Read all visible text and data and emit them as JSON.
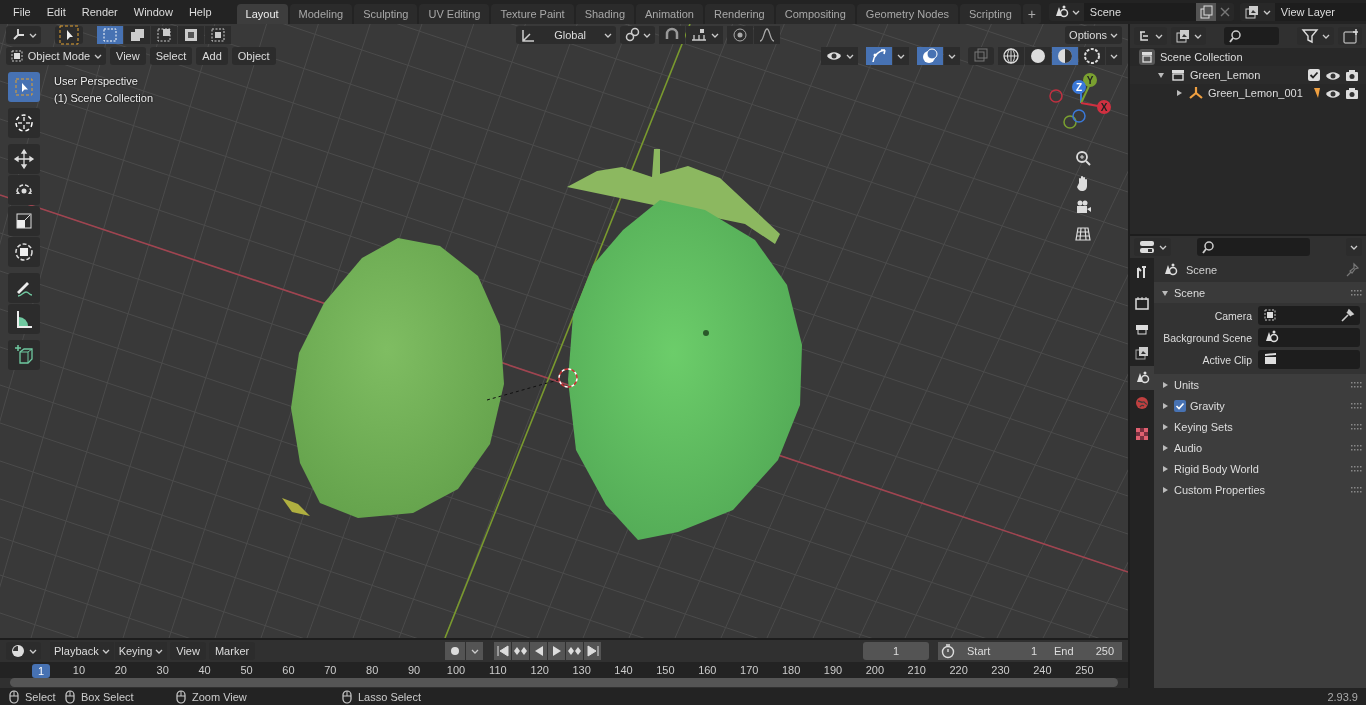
{
  "top_bar": {
    "menus": [
      "File",
      "Edit",
      "Render",
      "Window",
      "Help"
    ],
    "workspace_tabs": [
      {
        "label": "Layout",
        "selected": true
      },
      {
        "label": "Modeling",
        "selected": false
      },
      {
        "label": "Sculpting",
        "selected": false
      },
      {
        "label": "UV Editing",
        "selected": false
      },
      {
        "label": "Texture Paint",
        "selected": false
      },
      {
        "label": "Shading",
        "selected": false
      },
      {
        "label": "Animation",
        "selected": false
      },
      {
        "label": "Rendering",
        "selected": false
      },
      {
        "label": "Compositing",
        "selected": false
      },
      {
        "label": "Geometry Nodes",
        "selected": false
      },
      {
        "label": "Scripting",
        "selected": false
      }
    ],
    "add_workspace": "+",
    "scene": "Scene",
    "view_layer": "View Layer"
  },
  "viewport": {
    "header": {
      "select_modes": [
        {
          "selected": true
        },
        {
          "selected": false
        },
        {
          "selected": false
        },
        {
          "selected": false
        },
        {
          "selected": false
        }
      ],
      "orientation": "Global",
      "options": "Options",
      "mode": "Object Mode",
      "menus": [
        "View",
        "Select",
        "Add",
        "Object"
      ],
      "toggles": [
        {
          "selected": false
        },
        {
          "selected": true
        },
        {
          "selected": true
        }
      ],
      "shading_modes": [
        {
          "selected": false
        },
        {
          "selected": false
        },
        {
          "selected": true
        },
        {
          "selected": false
        }
      ]
    },
    "info": [
      "User Perspective",
      "(1) Scene Collection"
    ],
    "tools": [
      {
        "selected": true
      },
      {
        "selected": false
      },
      {
        "selected": false
      },
      {
        "selected": false
      },
      {
        "selected": false
      },
      {
        "selected": false
      },
      {
        "selected": false
      },
      {
        "selected": false
      },
      {
        "selected": false
      }
    ],
    "gizmo_labels": [
      "X",
      "Y",
      "Z"
    ]
  },
  "outliner": {
    "items": [
      {
        "label": "Scene Collection",
        "kind": "scene",
        "children": [
          {
            "label": "Green_Lemon",
            "kind": "collection",
            "expanded": true,
            "checked": true,
            "children": [
              {
                "label": "Green_Lemon_001",
                "kind": "object",
                "expanded": false
              }
            ]
          }
        ]
      }
    ]
  },
  "properties": {
    "tabs": [
      {
        "selected": false
      },
      {
        "selected": false
      },
      {
        "selected": false
      },
      {
        "selected": false
      },
      {
        "selected": true
      },
      {
        "selected": false
      },
      {
        "selected": false
      }
    ],
    "context": "Scene",
    "panels": [
      {
        "label": "Scene",
        "expanded": true,
        "fields": [
          {
            "label": "Camera",
            "kind": "object"
          },
          {
            "label": "Background Scene",
            "kind": "scene"
          },
          {
            "label": "Active Clip",
            "kind": "clip"
          }
        ]
      },
      {
        "label": "Units",
        "expanded": false
      },
      {
        "label": "Gravity",
        "expanded": false,
        "checked": true
      },
      {
        "label": "Keying Sets",
        "expanded": false
      },
      {
        "label": "Audio",
        "expanded": false
      },
      {
        "label": "Rigid Body World",
        "expanded": false
      },
      {
        "label": "Custom Properties",
        "expanded": false
      }
    ]
  },
  "timeline": {
    "dropdowns": [
      "Playback",
      "Keying"
    ],
    "menus": [
      "View",
      "Marker"
    ],
    "current_frame": "1",
    "start_label": "Start",
    "start": "1",
    "end_label": "End",
    "end": "250",
    "playhead": "1",
    "ruler": [
      "10",
      "20",
      "30",
      "40",
      "50",
      "60",
      "70",
      "80",
      "90",
      "100",
      "110",
      "120",
      "130",
      "140",
      "150",
      "160",
      "170",
      "180",
      "190",
      "200",
      "210",
      "220",
      "230",
      "240",
      "250"
    ]
  },
  "status_bar": {
    "hints": [
      "Select",
      "Box Select",
      "Zoom View",
      "Lasso Select"
    ],
    "version": "2.93.9"
  }
}
